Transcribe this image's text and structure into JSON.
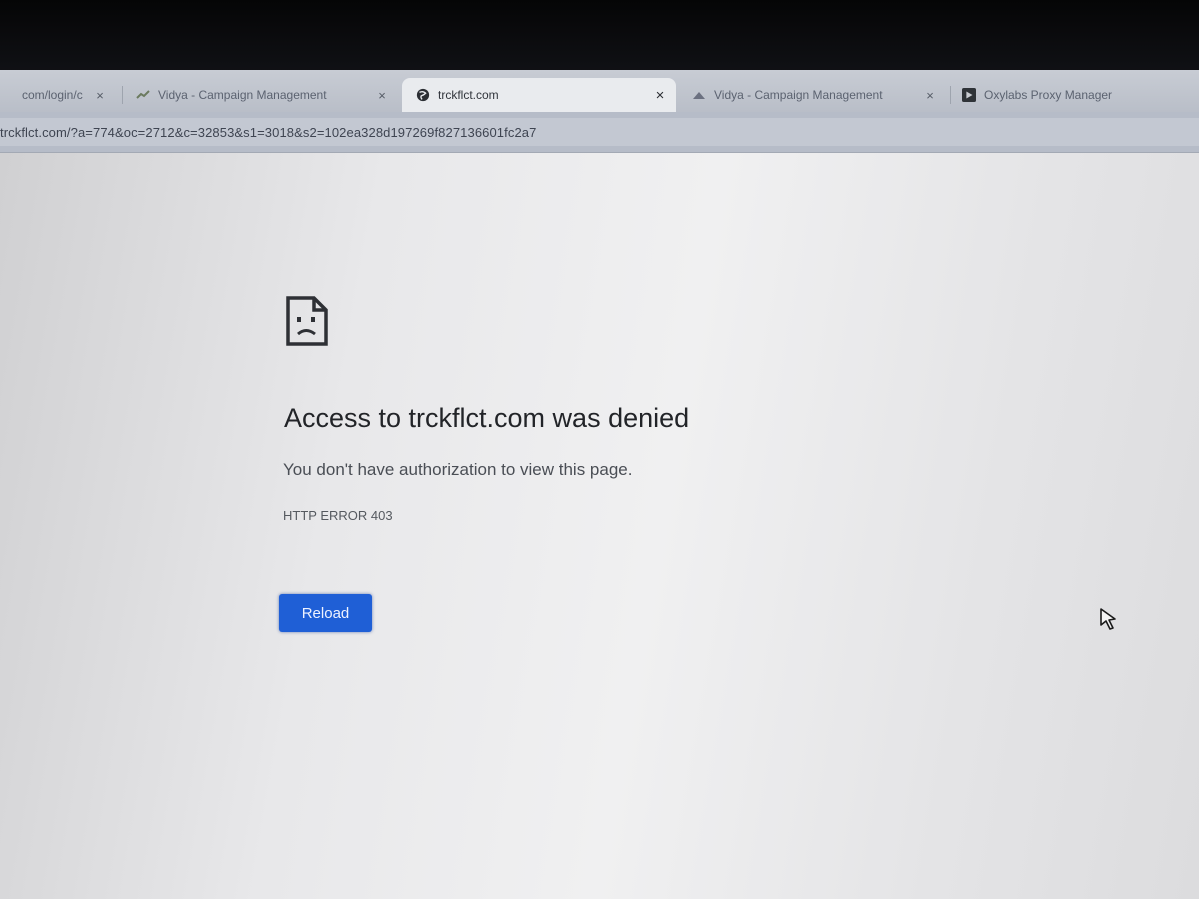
{
  "tabs": [
    {
      "title": "com/login/c",
      "close": "×",
      "favicon": "blank-page-icon",
      "active": false
    },
    {
      "title": "Vidya - Campaign Management",
      "close": "×",
      "favicon": "app-logo-icon",
      "active": false
    },
    {
      "title": "trckflct.com",
      "close": "×",
      "favicon": "globe-icon",
      "active": true
    },
    {
      "title": "Vidya - Campaign Management",
      "close": "×",
      "favicon": "app-logo-icon",
      "active": false
    },
    {
      "title": "Oxylabs Proxy Manager",
      "close": "",
      "favicon": "play-icon",
      "active": false
    }
  ],
  "address_bar": {
    "url": "trckflct.com/?a=774&oc=2712&c=32853&s1=3018&s2=102ea328d197269f827136601fc2a7"
  },
  "error_page": {
    "icon": "sad-document-icon",
    "heading": "Access to trckflct.com was denied",
    "message": "You don't have authorization to view this page.",
    "error_code": "HTTP ERROR 403",
    "reload_label": "Reload"
  },
  "colors": {
    "reload_button": "#1f5fd6",
    "heading_text": "#222428"
  }
}
